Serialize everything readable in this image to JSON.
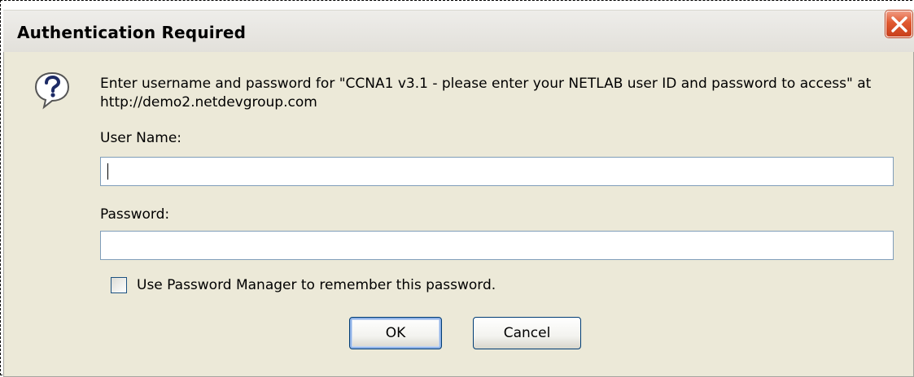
{
  "dialog": {
    "title": "Authentication Required",
    "message": "Enter username and password for \"CCNA1 v3.1 - please enter your NETLAB user ID and password to access\" at http://demo2.netdevgroup.com",
    "username_label": "User Name:",
    "username_value": "",
    "password_label": "Password:",
    "password_value": "",
    "remember_label": "Use Password Manager to remember this password.",
    "remember_checked": false,
    "ok_label": "OK",
    "cancel_label": "Cancel"
  },
  "icons": {
    "title_close": "close-icon",
    "prompt": "question-icon"
  },
  "colors": {
    "body_background": "#ece9d8",
    "close_button": "#e0582f",
    "input_border": "#7f9db9",
    "button_border": "#003c74"
  }
}
